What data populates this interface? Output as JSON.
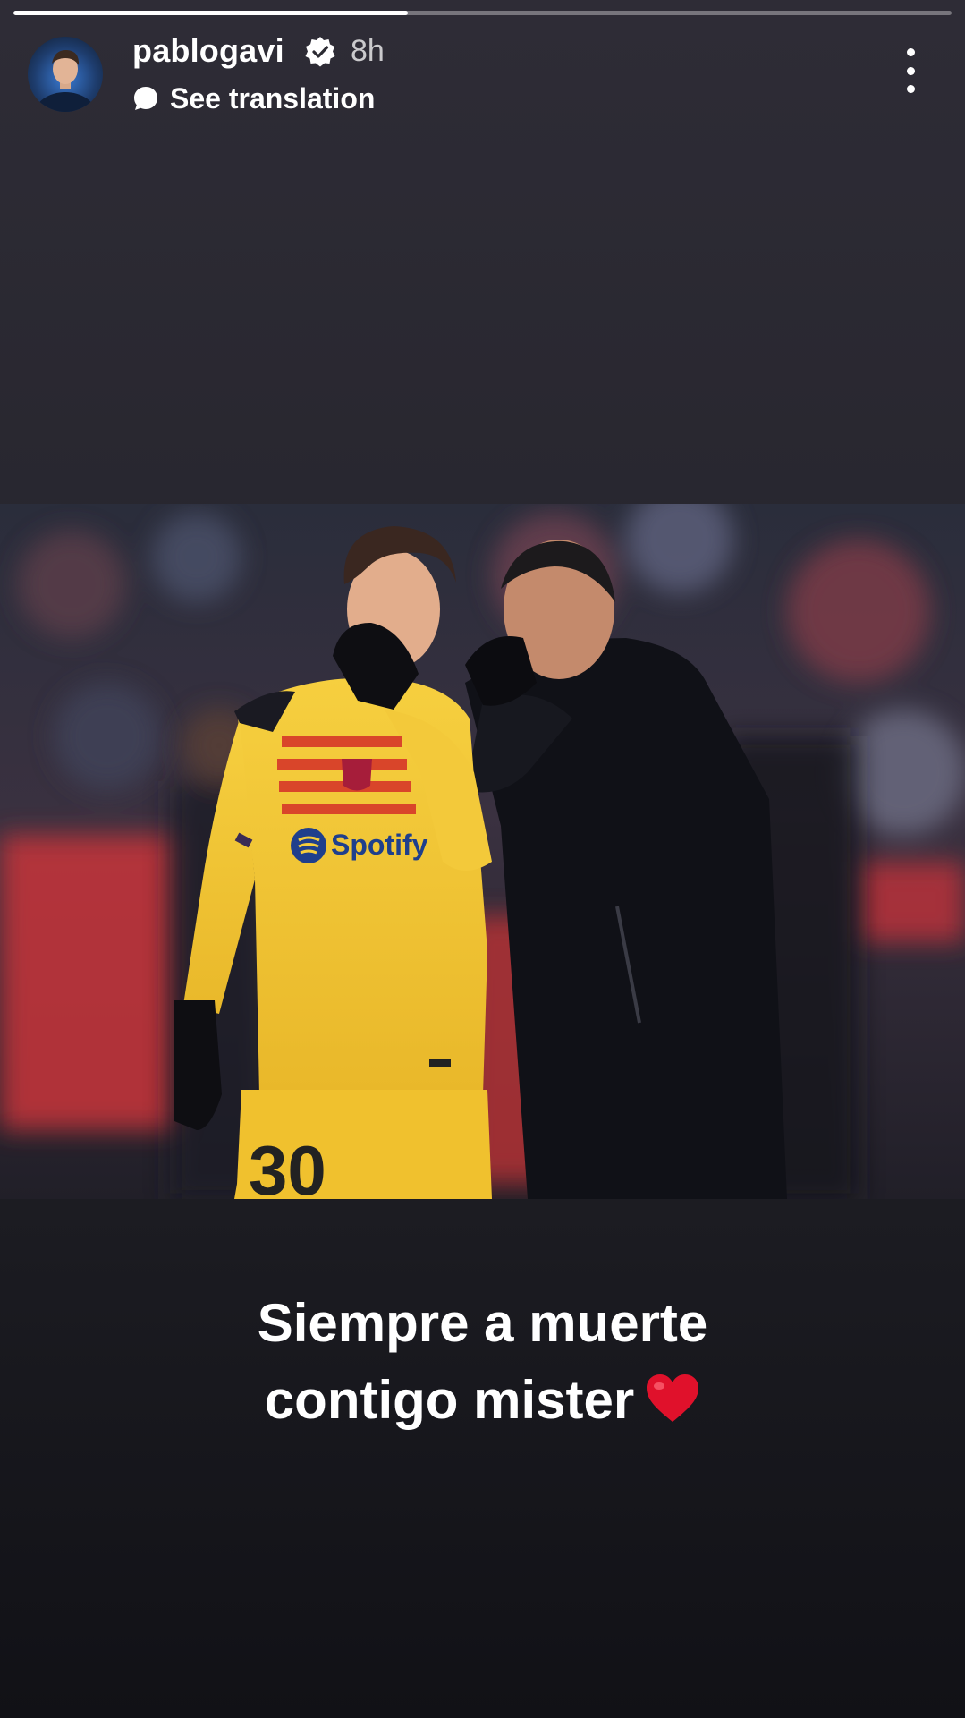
{
  "story": {
    "progress": 0.42,
    "colors": {
      "progress_fill": "#ffffff",
      "progress_track": "#6b6a72"
    }
  },
  "header": {
    "username": "pablogavi",
    "verified_icon": "verified-badge-icon",
    "time": "8h",
    "translation_label": "See translation",
    "more_icon": "more-vertical-icon"
  },
  "photo": {
    "jersey_sponsor": "Spotify",
    "jersey_number": "30"
  },
  "caption": {
    "line1": "Siempre a muerte",
    "line2": "contigo mister",
    "emoji_icon": "red-heart-icon"
  }
}
